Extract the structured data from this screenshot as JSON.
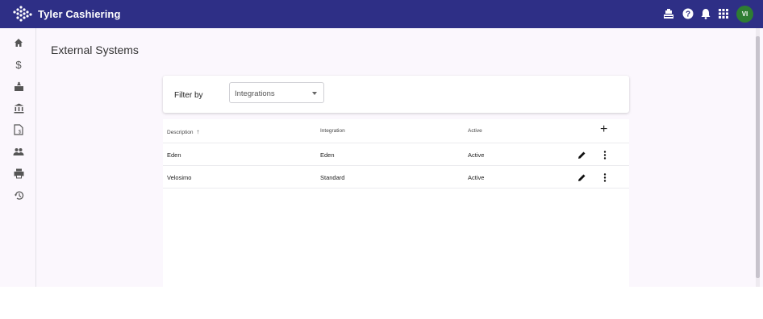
{
  "app": {
    "title": "Tyler Cashiering"
  },
  "topbar": {
    "icons": [
      "cashier-icon",
      "help-icon",
      "notifications-icon",
      "apps-grid-icon"
    ],
    "avatar_initials": "VI",
    "avatar_color": "#2e7d32",
    "bar_color": "#2e2f86"
  },
  "sidebar": {
    "items": [
      {
        "icon": "home-icon"
      },
      {
        "icon": "dollar-icon"
      },
      {
        "icon": "payments-icon"
      },
      {
        "icon": "bank-icon"
      },
      {
        "icon": "document-icon"
      },
      {
        "icon": "users-icon"
      },
      {
        "icon": "printer-icon"
      },
      {
        "icon": "history-icon"
      }
    ]
  },
  "page": {
    "title": "External Systems"
  },
  "filter": {
    "label": "Filter by",
    "selected": "Integrations"
  },
  "table": {
    "headers": {
      "description": "Description",
      "sort_arrow": "↑",
      "integration": "Integration",
      "active": "Active",
      "add": "+"
    },
    "rows": [
      {
        "description": "Eden",
        "integration": "Eden",
        "active": "Active"
      },
      {
        "description": "Velosimo",
        "integration": "Standard",
        "active": "Active"
      }
    ]
  }
}
